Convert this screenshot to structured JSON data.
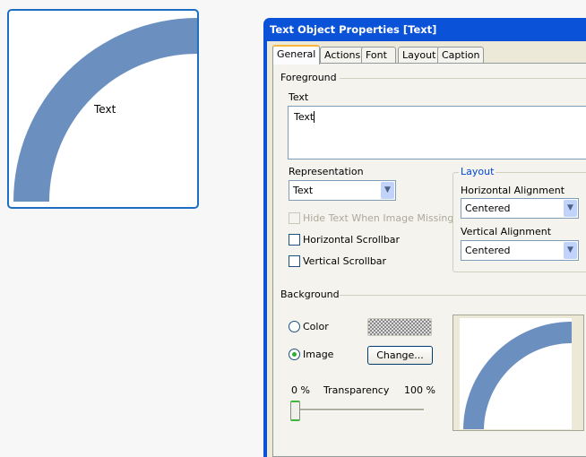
{
  "text_object": {
    "label": "Text",
    "arc_color": "#6b8fbf"
  },
  "dialog": {
    "title": "Text Object Properties [Text]",
    "tabs": [
      "General",
      "Actions",
      "Font",
      "Layout",
      "Caption"
    ],
    "active_tab": "General",
    "foreground": {
      "heading": "Foreground",
      "text_label": "Text",
      "text_value": "Text",
      "representation_label": "Representation",
      "representation_value": "Text",
      "hide_text_label": "Hide Text When Image Missing",
      "hide_text_checked": false,
      "hide_text_enabled": false,
      "h_scroll_label": "Horizontal Scrollbar",
      "h_scroll_checked": false,
      "v_scroll_label": "Vertical Scrollbar",
      "v_scroll_checked": false
    },
    "layout": {
      "heading": "Layout",
      "h_align_label": "Horizontal Alignment",
      "h_align_value": "Centered",
      "v_align_label": "Vertical Alignment",
      "v_align_value": "Centered"
    },
    "background": {
      "heading": "Background",
      "color_label": "Color",
      "image_label": "Image",
      "selected": "Image",
      "change_label": "Change...",
      "transparency_label": "Transparency",
      "min_label": "0 %",
      "max_label": "100 %",
      "transparency_percent": 0
    }
  }
}
